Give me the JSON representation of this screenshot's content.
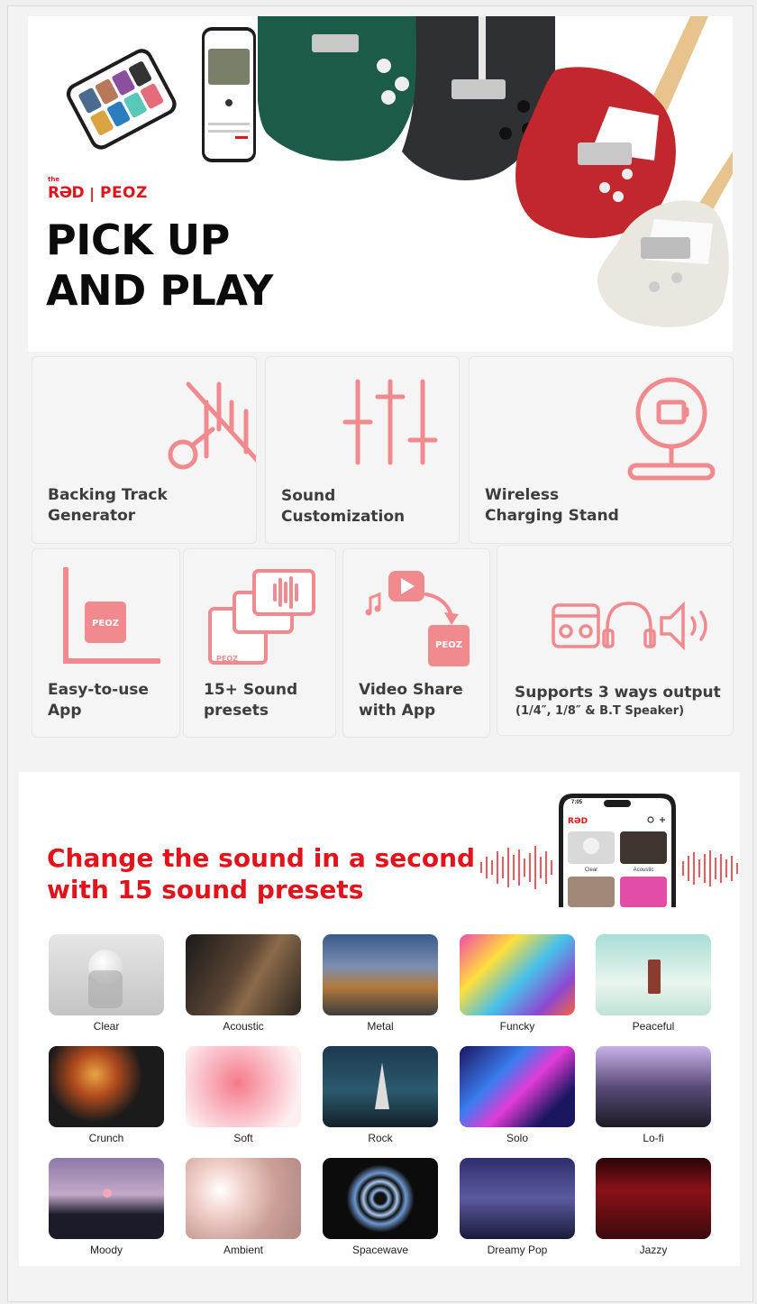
{
  "hero": {
    "brand_the": "the",
    "brand_red": "RƏD",
    "brand_sep": "|",
    "brand_peoz": "PEOZ",
    "headline": "PICK UP\nAND PLAY"
  },
  "features": [
    {
      "label": "Backing Track\nGenerator",
      "icon": "guitar-no-track-icon"
    },
    {
      "label": "Sound\nCustomization",
      "icon": "sliders-icon"
    },
    {
      "label": "Wireless\nCharging Stand",
      "icon": "charging-stand-icon"
    },
    {
      "label": "Easy-to-use\nApp",
      "icon": "app-icon",
      "icon_text": "PEOZ"
    },
    {
      "label": "15+ Sound\npresets",
      "icon": "presets-icon",
      "icon_text": "PEOZ"
    },
    {
      "label": "Video Share\nwith App",
      "icon": "video-share-icon",
      "icon_text": "PEOZ"
    },
    {
      "label": "Supports 3 ways output",
      "sub": "(1/4″, 1/8″ & B.T Speaker)",
      "icon": "output-icon"
    }
  ],
  "sound": {
    "title": "Change the sound in a second\nwith 15 sound presets",
    "phone_time": "7:05",
    "phone_brand": "RƏD",
    "phone_tile_1": "Clear",
    "phone_tile_2": "Acoustic",
    "presets": [
      "Clear",
      "Acoustic",
      "Metal",
      "Funcky",
      "Peaceful",
      "Crunch",
      "Soft",
      "Rock",
      "Solo",
      "Lo-fi",
      "Moody",
      "Ambient",
      "Spacewave",
      "Dreamy Pop",
      "Jazzy"
    ]
  },
  "colors": {
    "accent": "#e3131b",
    "icon_pink": "#f08a8e",
    "card_bg": "#f5f5f5"
  }
}
